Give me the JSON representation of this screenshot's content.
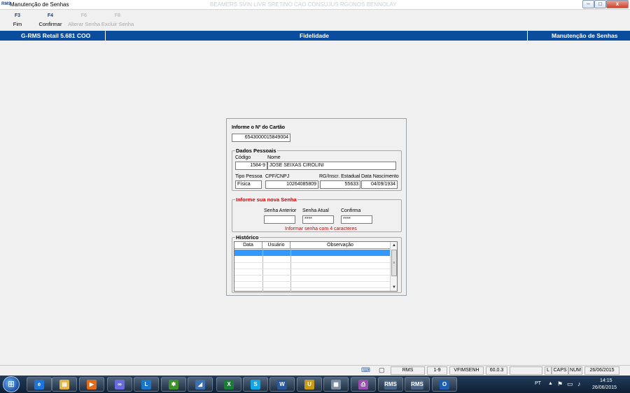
{
  "window": {
    "title": "Manutenção de Senhas",
    "app_icon_text": "RMS",
    "faded_title": "BEAMERS SVIN LIVR SRETINO CAO CONSUJUS RGONOS BENNOLAY",
    "controls": {
      "minimize": "–",
      "maximize": "□",
      "close": "x"
    }
  },
  "toolbar": {
    "keys": [
      {
        "key": "F3",
        "label": "Fim",
        "enabled": true
      },
      {
        "key": "F4",
        "label": "Confirmar",
        "enabled": true
      },
      {
        "key": "F6",
        "label": "Alterar Senha",
        "enabled": false
      },
      {
        "key": "F8",
        "label": "Excluir Senha",
        "enabled": false
      }
    ]
  },
  "header": {
    "left": "G-RMS Retail 5.681 COO",
    "center": "Fidelidade",
    "right": "Manutenção de Senhas"
  },
  "form": {
    "card_label": "Informe o Nº do Cartão",
    "card_value": "6543000015849004",
    "personal": {
      "title": "Dados Pessoais",
      "code_label": "Código",
      "name_label": "Nome",
      "code_value": "1584-9",
      "name_value": "JOSE SEIXAS CIROLINI",
      "tipo_label": "Tipo Pessoa",
      "tipo_value": "Física",
      "cpf_label": "CPF/CNPJ",
      "cpf_value": "10264085809",
      "rg_label": "RG/Inscr. Estadual",
      "rg_value": "55633",
      "nasc_label": "Data Nascimento",
      "nasc_value": "04/09/1934"
    },
    "password": {
      "title": "Informe sua nova Senha",
      "anterior_label": "Senha Anterior",
      "anterior_value": "",
      "atual_label": "Senha Atual",
      "atual_value": "****",
      "confirma_label": "Confirma",
      "confirma_value": "****",
      "hint": "Informar senha com 4 caracteres"
    },
    "history": {
      "title": "Histórico",
      "columns": [
        "Data",
        "Usuário",
        "Observação"
      ]
    }
  },
  "statusbar": {
    "rms": "RMS",
    "range": "1-9",
    "program": "VFIMSENH",
    "version": "60.0.3",
    "blank": "",
    "l": "L",
    "caps": "CAPS",
    "num": "NUM",
    "date": "26/06/2015"
  },
  "taskbar": {
    "start_glyph": "⊞",
    "items": [
      {
        "name": "ie",
        "glyph": "e",
        "color": "#1e74d6"
      },
      {
        "name": "explorer",
        "glyph": "▤",
        "color": "#e2b443"
      },
      {
        "name": "media",
        "glyph": "▶",
        "color": "#e06b1a"
      },
      {
        "name": "loop",
        "glyph": "∞",
        "color": "#6a6adf"
      },
      {
        "name": "lync",
        "glyph": "L",
        "color": "#1b75c9"
      },
      {
        "name": "app-green",
        "glyph": "✱",
        "color": "#3f8f2a"
      },
      {
        "name": "app-blue",
        "glyph": "◢",
        "color": "#3d6fb3"
      },
      {
        "name": "excel",
        "glyph": "X",
        "color": "#1e7a3a"
      },
      {
        "name": "skype",
        "glyph": "S",
        "color": "#12a5e8"
      },
      {
        "name": "word",
        "glyph": "W",
        "color": "#2a5699"
      },
      {
        "name": "uf",
        "glyph": "U",
        "color": "#c79b16"
      },
      {
        "name": "calculator",
        "glyph": "▦",
        "color": "#7a8da3"
      },
      {
        "name": "printer",
        "glyph": "⎙",
        "color": "#9a4fb0"
      },
      {
        "name": "rms-1",
        "glyph": "RMS",
        "color": "#4a6584"
      },
      {
        "name": "rms-2",
        "glyph": "RMS",
        "color": "#4a6584"
      },
      {
        "name": "outlook",
        "glyph": "O",
        "color": "#1c5fb5"
      }
    ],
    "lang": "PT",
    "time": "14:15",
    "date": "26/06/2015"
  }
}
